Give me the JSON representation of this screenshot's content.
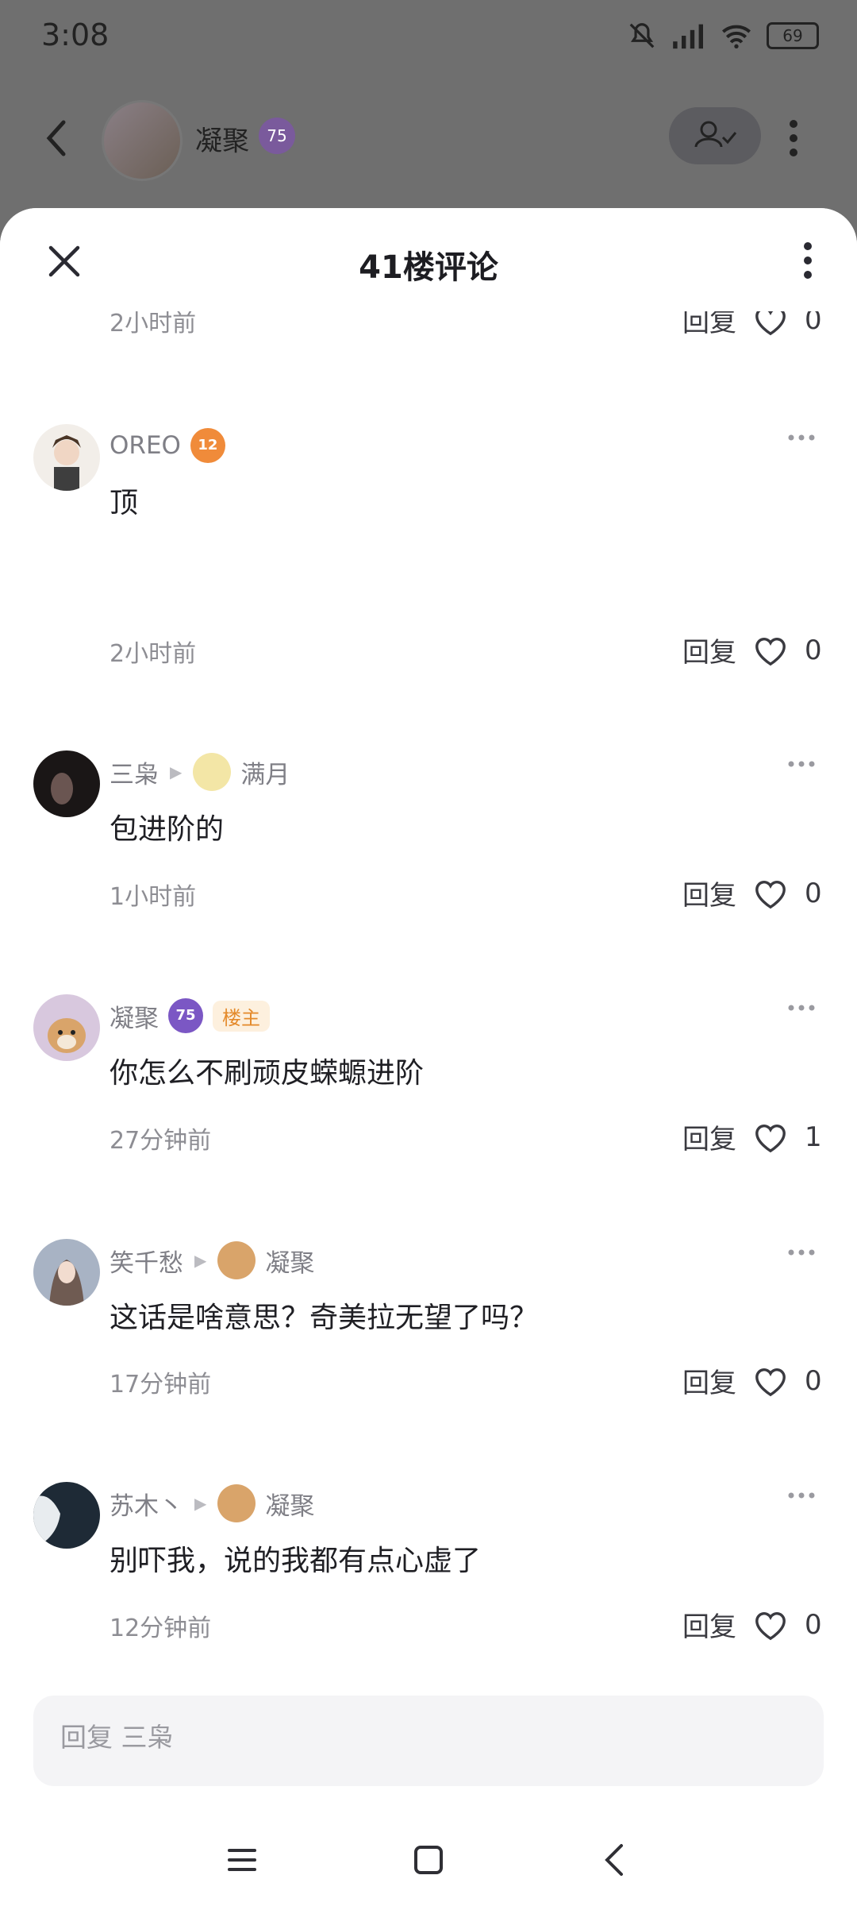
{
  "status": {
    "time": "3:08",
    "battery": "69"
  },
  "background_page": {
    "username": "凝聚",
    "level": "75"
  },
  "sheet": {
    "title": "41楼评论"
  },
  "top_partial": {
    "time": "2小时前",
    "reply": "回复",
    "likes": "0"
  },
  "comments": [
    {
      "user": "OREO",
      "level": "12",
      "text": "顶",
      "time": "2小时前",
      "reply": "回复",
      "likes": "0"
    },
    {
      "user": "三枭",
      "reply_to": "满月",
      "text": "包进阶的",
      "time": "1小时前",
      "reply": "回复",
      "likes": "0"
    },
    {
      "user": "凝聚",
      "level": "75",
      "tag": "楼主",
      "text": "你怎么不刷顽皮蝾螈进阶",
      "time": "27分钟前",
      "reply": "回复",
      "likes": "1"
    },
    {
      "user": "笑千愁",
      "reply_to": "凝聚",
      "text": "这话是啥意思？奇美拉无望了吗？",
      "time": "17分钟前",
      "reply": "回复",
      "likes": "0"
    },
    {
      "user": "苏木丶",
      "reply_to": "凝聚",
      "text": "别吓我，说的我都有点心虚了",
      "time": "12分钟前",
      "reply": "回复",
      "likes": "0"
    }
  ],
  "input": {
    "placeholder": "回复 三枭"
  },
  "colors": {
    "level_purple": "#7b57c4",
    "level_orange": "#f08b3a",
    "host_tag": "#e48a2b"
  },
  "icons": [
    "close-icon",
    "more-vertical-icon",
    "more-horizontal-icon",
    "heart-icon",
    "back-icon",
    "follow-icon",
    "menu-icon",
    "home-icon",
    "nav-back-icon"
  ]
}
